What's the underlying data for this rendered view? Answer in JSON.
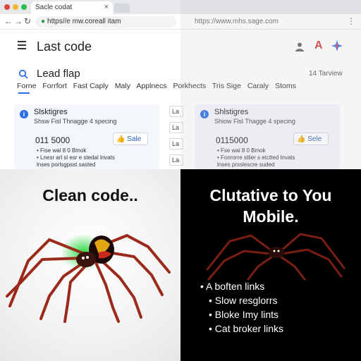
{
  "browser": {
    "tab_title": "Sacle codat",
    "tab_close": "×",
    "address": "https//e mw.coreall itam",
    "address2": "https://www.mhs.sage.com",
    "dot_colors": [
      "#e0453b",
      "#f2b631",
      "#2bbf4e"
    ]
  },
  "app": {
    "title": "Last code",
    "search_title": "Lead flap",
    "count": "14 Tarview",
    "filters": [
      "Forne",
      "Forrfort",
      "Fast Caply",
      "Maly",
      "Applnecs",
      "Porkhects",
      "Tris Sige",
      "Caraly",
      "Stoms"
    ]
  },
  "cards": [
    {
      "title": "Slsktigres",
      "subtitle": "Shsw Fisl Thnagge 4 specing",
      "number": "011 5000",
      "button": "Sale",
      "bullets": [
        "Fise wal 8 0 Bmok",
        "Lnesr arl sl esr e stedal lnvats",
        "lnses porlsgpsst sasted"
      ]
    },
    {
      "title": "Shlstigres",
      "subtitle": "Shiow Flsl Thagge 4 specing",
      "number": "0115000",
      "button": "Sele",
      "bullets": [
        "Fse wal 8 0 Bmok",
        "Fonrorre stlier s etctted lnvats",
        "lnses prsslescre suded"
      ]
    }
  ],
  "side_buttons": [
    "La",
    "La",
    "La",
    "La"
  ],
  "left_panel": {
    "headline": "Clean code.."
  },
  "right_panel": {
    "headline_line1": "Clutative to You",
    "headline_line2": "Mobile.",
    "bullets": [
      "A boften links",
      "Slow resglorrs",
      "Bloke Imy lints",
      "Cat broker links"
    ]
  },
  "colors": {
    "accent": "#2a6ee6",
    "spider_body": "#a0291c",
    "spider_glow": "#22d83a",
    "dark_bg": "#000000"
  },
  "icons": [
    "hamburger-icon",
    "person-icon",
    "logo-a-icon",
    "logo-star-icon",
    "search-icon",
    "info-icon",
    "thumb-icon",
    "spider-image"
  ]
}
